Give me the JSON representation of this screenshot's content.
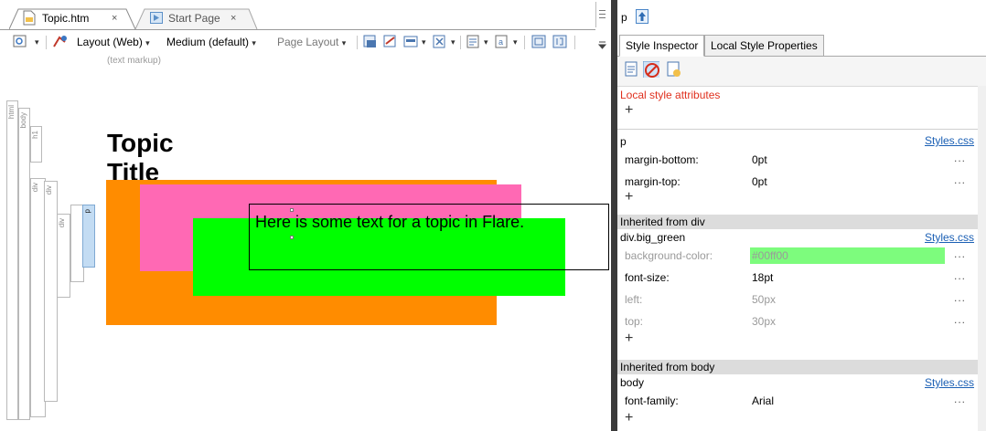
{
  "editor": {
    "tabs": [
      {
        "label": "Topic.htm",
        "close": "×",
        "active": true
      },
      {
        "label": "Start Page",
        "close": "×",
        "active": false
      }
    ],
    "toolbar": {
      "layout_label": "Layout (Web)",
      "medium_label": "Medium (default)",
      "page_layout_label": "Page Layout",
      "caret": "▾"
    },
    "markup_hint": "(text markup)",
    "tag_bars": [
      "html",
      "body",
      "h1",
      "div",
      "div",
      "div",
      "p"
    ],
    "topic_title": "Topic Title",
    "paragraph_text": "Here is some text for a topic in Flare.",
    "colors": {
      "orange_div": "#ff8c00",
      "pink_div": "#ff69b4",
      "green_div": "#00ff00"
    }
  },
  "inspector": {
    "element_label": "p",
    "tabs": [
      {
        "label": "Style Inspector",
        "active": true
      },
      {
        "label": "Local Style Properties",
        "active": false
      }
    ],
    "local_style_title": "Local style attributes",
    "plus": "+",
    "more": "...",
    "sections": {
      "p": {
        "selector": "p",
        "link": "Styles.css",
        "props": [
          {
            "name": "margin-bottom:",
            "value": "0pt"
          },
          {
            "name": "margin-top:",
            "value": "0pt"
          }
        ]
      },
      "div": {
        "header": "Inherited from div",
        "selector": "div.big_green",
        "link": "Styles.css",
        "props": [
          {
            "name": "background-color:",
            "value": "#00ff00"
          },
          {
            "name": "font-size:",
            "value": "18pt"
          },
          {
            "name": "left:",
            "value": "50px"
          },
          {
            "name": "top:",
            "value": "30px"
          }
        ]
      },
      "body": {
        "header": "Inherited from body",
        "selector": "body",
        "link": "Styles.css",
        "props": [
          {
            "name": "font-family:",
            "value": "Arial"
          }
        ]
      }
    }
  }
}
